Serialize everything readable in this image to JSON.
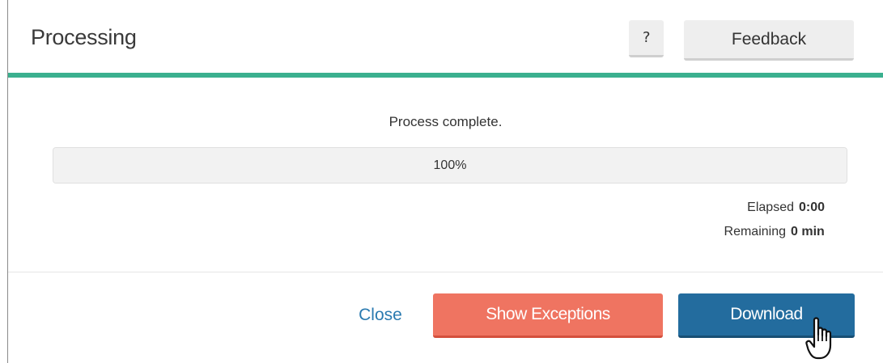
{
  "dialog": {
    "title": "Processing",
    "help_label": "?",
    "feedback_label": "Feedback"
  },
  "progress": {
    "status": "Process complete.",
    "percent_label": "100%",
    "fraction": 1.0
  },
  "stats": {
    "elapsed_label": "Elapsed",
    "elapsed_value": "0:00",
    "remaining_label": "Remaining",
    "remaining_value": "0 min"
  },
  "footer": {
    "close_label": "Close",
    "exceptions_label": "Show Exceptions",
    "download_label": "Download"
  },
  "colors": {
    "accent": "#3bb08f",
    "exceptions": "#ef7461",
    "download": "#236c9e",
    "link": "#2a7ab0"
  },
  "cursor": {
    "icon": "hand-pointer-icon"
  }
}
